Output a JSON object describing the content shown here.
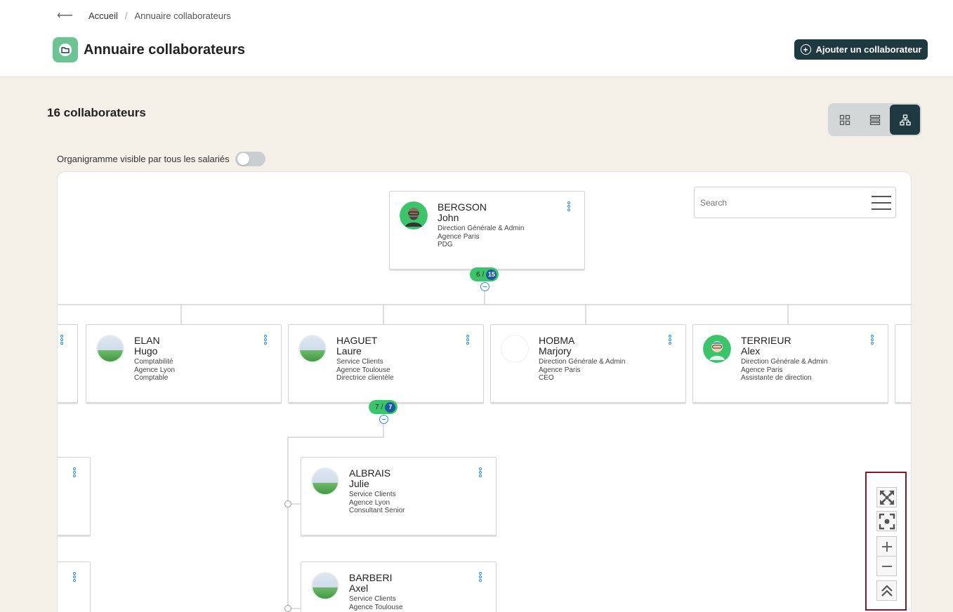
{
  "breadcrumb": {
    "back_icon": "arrow-left-icon",
    "home": "Accueil",
    "separator": "/",
    "current": "Annuaire collaborateurs"
  },
  "header": {
    "title": "Annuaire collaborateurs",
    "add_button": "Ajouter un collaborateur",
    "accent": "#1e3a40",
    "icon_bg": "#6cc494"
  },
  "count_label": "16 collaborateurs",
  "view_switch": {
    "options": [
      "grid-view-icon",
      "list-view-icon",
      "org-chart-icon"
    ],
    "active": "org-chart-icon"
  },
  "visibility_label": "Organigramme visible par tous les salariés",
  "visibility_toggle": false,
  "search": {
    "placeholder": "Search"
  },
  "root": {
    "last": "BERGSON",
    "first": "John",
    "dept": "Direction Générale & Admin",
    "agency": "Agence Paris",
    "role": "PDG",
    "badge_count": "6",
    "badge_sep": "/",
    "badge_total": "15"
  },
  "level1": [
    {
      "last": "ELAN",
      "first": "Hugo",
      "dept": "Comptabilité",
      "agency": "Agence Lyon",
      "role": "Comptable"
    },
    {
      "last": "HAGUET",
      "first": "Laure",
      "dept": "Service Clients",
      "agency": "Agence Toulouse",
      "role": "Directrice clientèle",
      "badge_count": "7",
      "badge_sep": "/",
      "badge_total": "7"
    },
    {
      "last": "HOBMA",
      "first": "Marjory",
      "dept": "Direction Générale & Admin",
      "agency": "Agence Paris",
      "role": "CEO"
    },
    {
      "last": "TERRIEUR",
      "first": "Alex",
      "dept": "Direction Générale & Admin",
      "agency": "Agence Paris",
      "role": "Assistante de direction"
    }
  ],
  "level2": [
    {
      "last": "ALBRAIS",
      "first": "Julie",
      "dept": "Service Clients",
      "agency": "Agence Lyon",
      "role": "Consultant Senior"
    },
    {
      "last": "BARBERI",
      "first": "Axel",
      "dept": "Service Clients",
      "agency": "Agence Toulouse",
      "role": ""
    }
  ],
  "zoom_controls": [
    "fit-screen-icon",
    "center-icon",
    "zoom-in-icon",
    "zoom-out-icon",
    "collapse-all-icon"
  ]
}
